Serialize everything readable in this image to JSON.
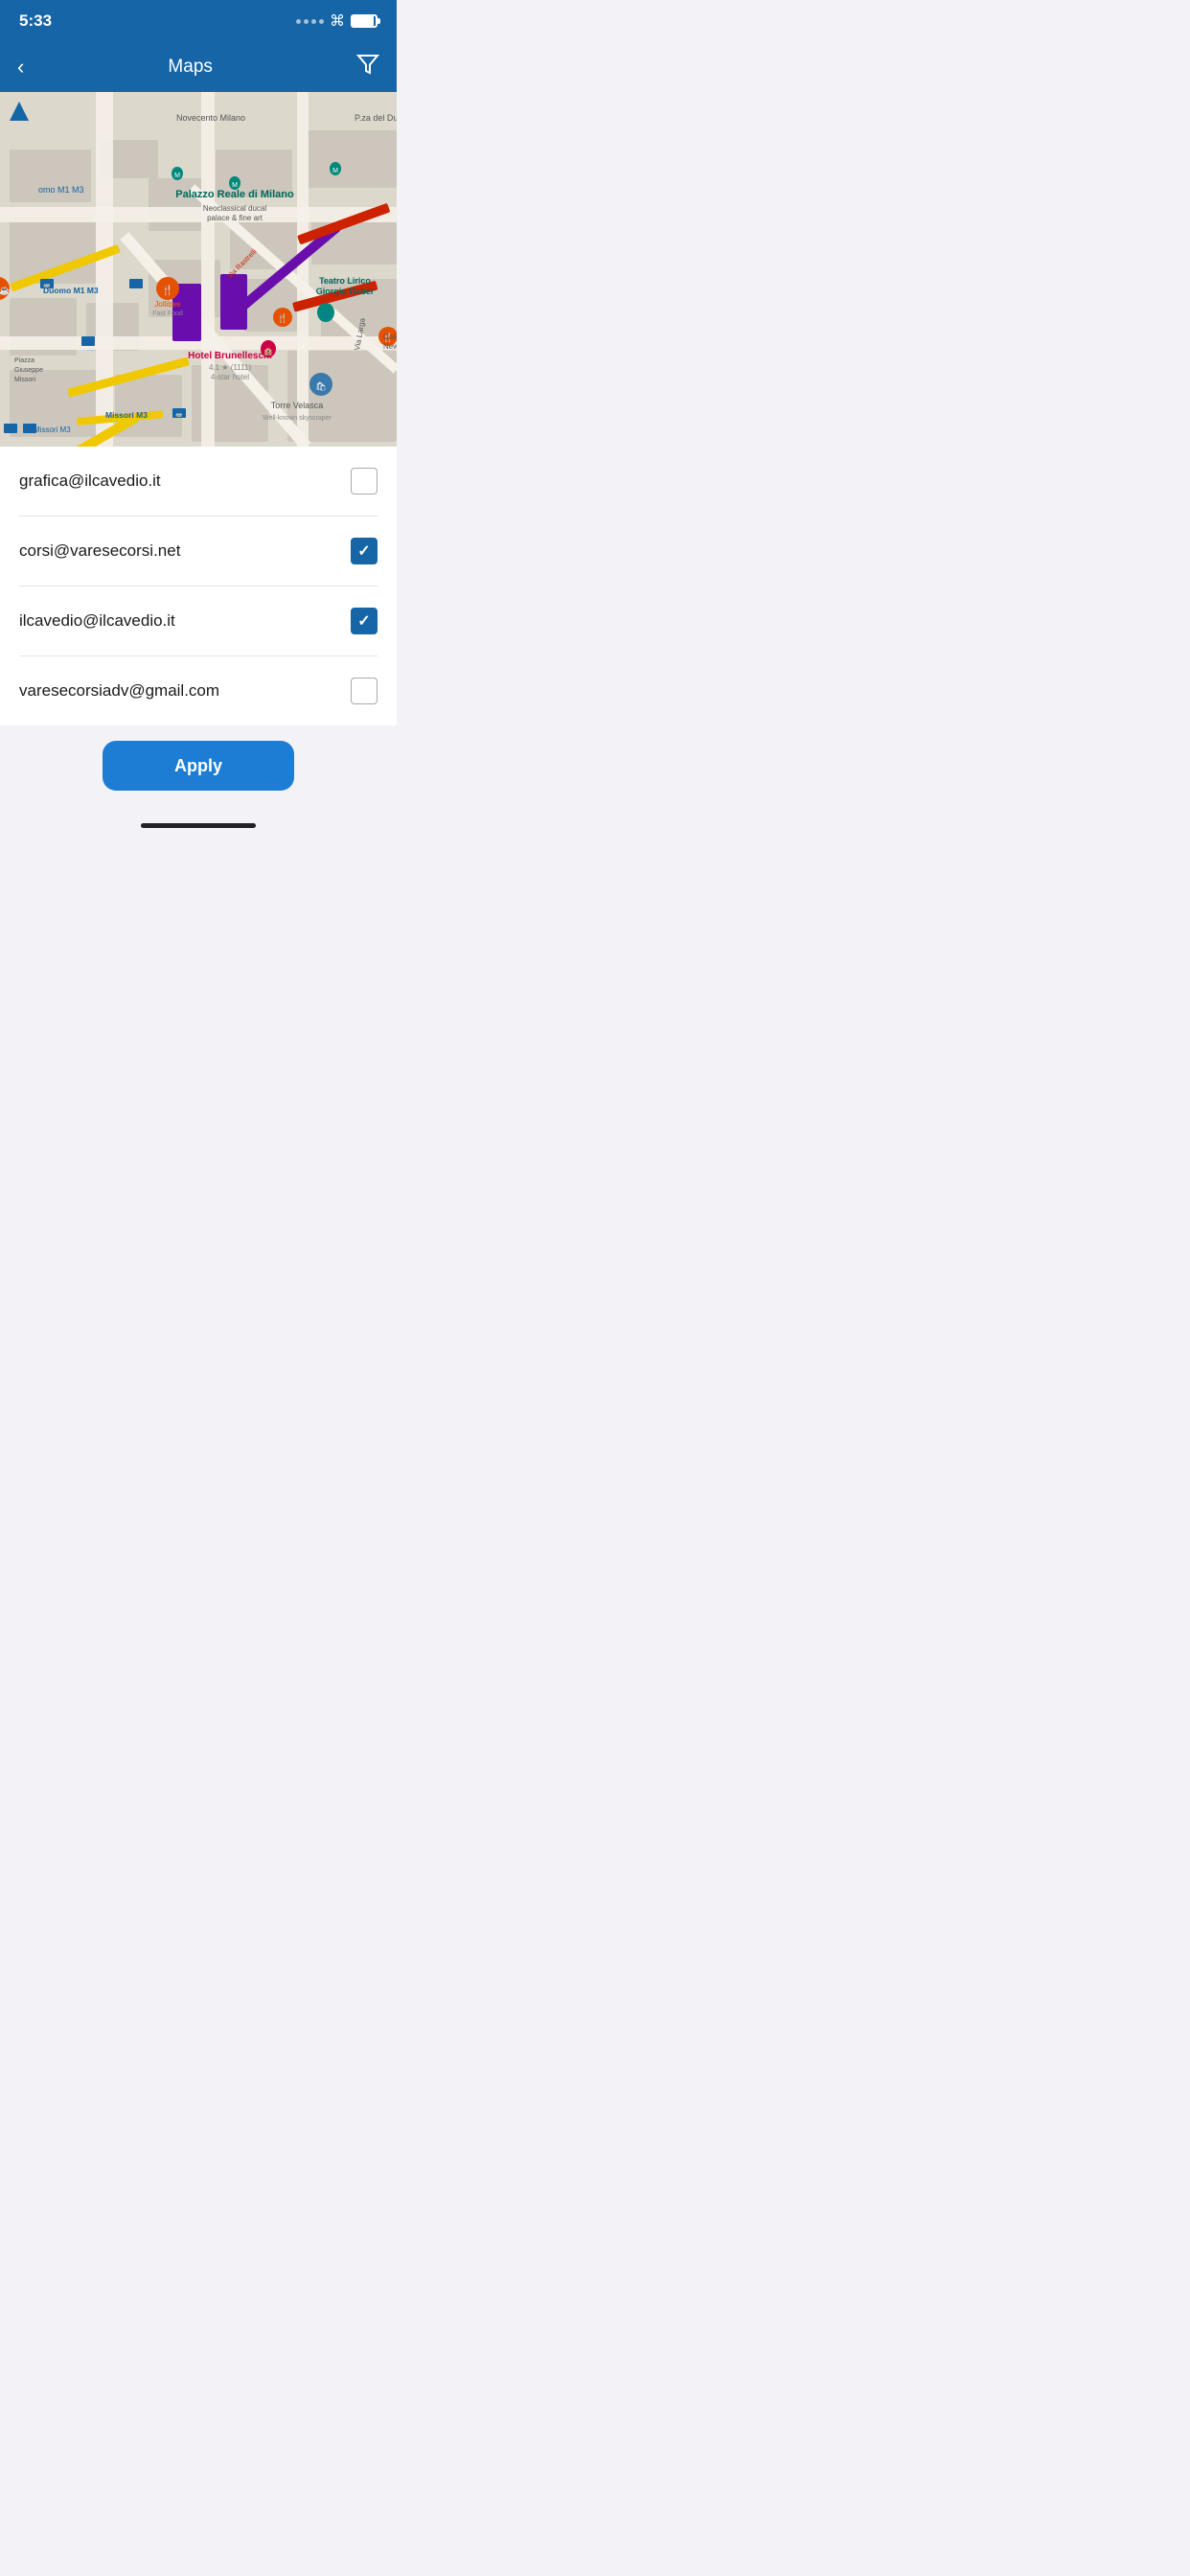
{
  "statusBar": {
    "time": "5:33"
  },
  "navBar": {
    "title": "Maps",
    "backLabel": "‹",
    "filterLabel": "⛉"
  },
  "checklist": {
    "items": [
      {
        "id": 1,
        "email": "grafica@ilcavedio.it",
        "checked": false
      },
      {
        "id": 2,
        "email": "corsi@varesecorsi.net",
        "checked": true
      },
      {
        "id": 3,
        "email": "ilcavedio@ilcavedio.it",
        "checked": true
      },
      {
        "id": 4,
        "email": "varesecorsiadv@gmail.com",
        "checked": false
      }
    ]
  },
  "applyButton": {
    "label": "Apply"
  },
  "map": {
    "locationLabel": "Palazzo Reale di Milano",
    "locationSub": "Neoclassical ducal palace & fine art",
    "hotel": "Hotel Brunelleschi",
    "hotelRating": "4.1 ★ (1111)",
    "hotelType": "4-star hotel",
    "jollibee": "Jollibee",
    "jollibeeType": "Fast Food",
    "teatro": "Teatro Lirico Giorgio Gaber",
    "torre": "Torre Velasca",
    "torreSub": "Well-known skyscraper",
    "duomo": "Duomo M1 M3",
    "missori": "Missori M3",
    "viaLarga": "Via Larga"
  },
  "colors": {
    "navBg": "#1565a7",
    "applyBtn": "#1d7cd4",
    "checkedBg": "#1565a7"
  }
}
